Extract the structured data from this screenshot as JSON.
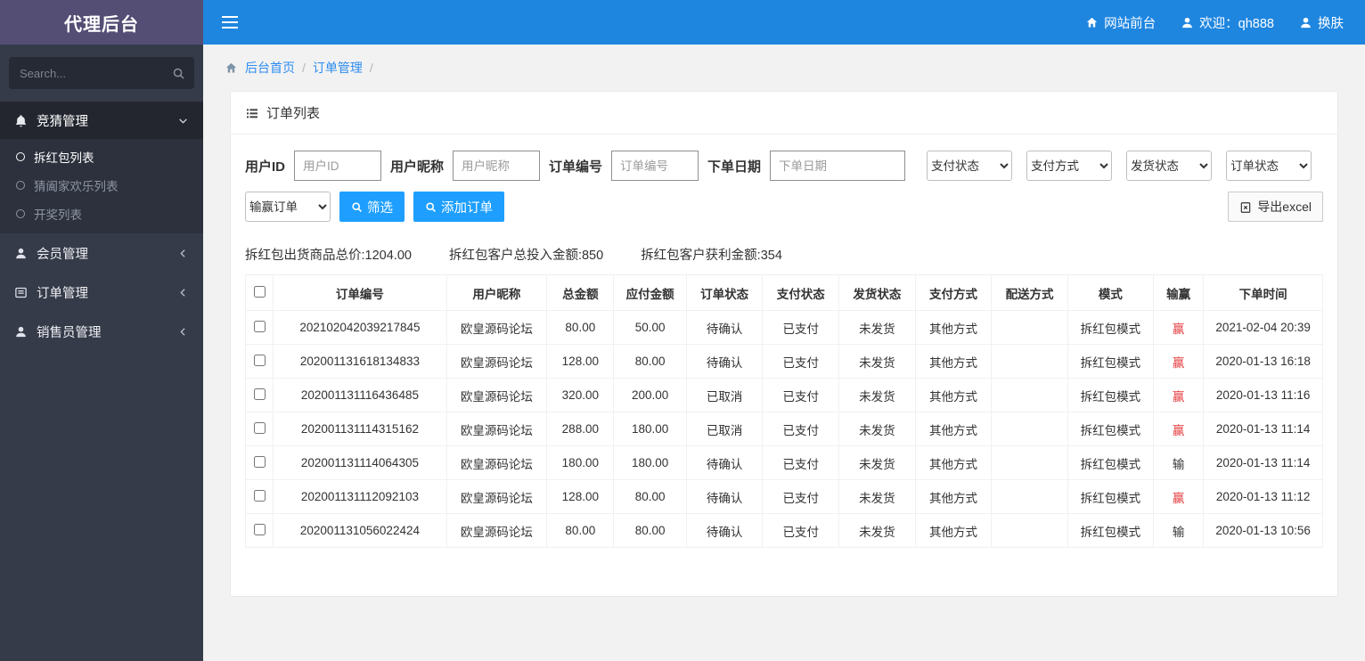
{
  "colors": {
    "topbar_blue": "#1f86e0",
    "brand_purple": "#544e75",
    "button_blue": "#1e9fff",
    "link_blue": "#2d8cf0",
    "win_red": "#e4393c",
    "sidebar_dark": "#363b4a"
  },
  "sidebar": {
    "brand": "代理后台",
    "search_placeholder": "Search...",
    "section": {
      "label": "竞猜管理",
      "items": [
        {
          "label": "拆红包列表",
          "active": true
        },
        {
          "label": "猜阖家欢乐列表",
          "active": false
        },
        {
          "label": "开奖列表",
          "active": false
        }
      ]
    },
    "items": [
      {
        "label": "会员管理"
      },
      {
        "label": "订单管理"
      },
      {
        "label": "销售员管理"
      }
    ]
  },
  "topbar": {
    "links": [
      {
        "label": "网站前台"
      },
      {
        "label": "欢迎：qh888"
      },
      {
        "label": "换肤"
      }
    ]
  },
  "breadcrumb": {
    "items": [
      {
        "label": "后台首页"
      },
      {
        "label": "订单管理"
      }
    ],
    "separator": "/"
  },
  "panel": {
    "title": "订单列表",
    "filters": {
      "user_id_label": "用户ID",
      "user_id_placeholder": "用户ID",
      "nickname_label": "用户昵称",
      "nickname_placeholder": "用户昵称",
      "order_no_label": "订单编号",
      "order_no_placeholder": "订单编号",
      "date_label": "下单日期",
      "date_placeholder": "下单日期",
      "selects": [
        "支付状态",
        "支付方式",
        "发货状态",
        "订单状态"
      ],
      "win_lose_select": "输赢订单",
      "filter_button": "筛选",
      "add_button": "添加订单",
      "export_button": "导出excel"
    },
    "stats": [
      "拆红包出货商品总价:1204.00",
      "拆红包客户总投入金额:850",
      "拆红包客户获利金额:354"
    ],
    "table": {
      "columns": [
        {
          "label": "订单编号",
          "blue": true
        },
        {
          "label": "用户昵称",
          "blue": true
        },
        {
          "label": "总金额",
          "blue": true
        },
        {
          "label": "应付金额",
          "blue": true
        },
        {
          "label": "订单状态",
          "blue": true
        },
        {
          "label": "支付状态",
          "blue": false
        },
        {
          "label": "发货状态",
          "blue": false
        },
        {
          "label": "支付方式",
          "blue": false
        },
        {
          "label": "配送方式",
          "blue": false
        },
        {
          "label": "模式",
          "blue": false
        },
        {
          "label": "输赢",
          "blue": false
        },
        {
          "label": "下单时间",
          "blue": true
        }
      ],
      "rows": [
        {
          "order_no": "202102042039217845",
          "nickname": "欧皇源码论坛",
          "total": "80.00",
          "payable": "50.00",
          "order_status": "待确认",
          "pay_status": "已支付",
          "ship_status": "未发货",
          "pay_method": "其他方式",
          "delivery": "",
          "mode": "拆红包模式",
          "result": "赢",
          "time": "2021-02-04 20:39"
        },
        {
          "order_no": "202001131618134833",
          "nickname": "欧皇源码论坛",
          "total": "128.00",
          "payable": "80.00",
          "order_status": "待确认",
          "pay_status": "已支付",
          "ship_status": "未发货",
          "pay_method": "其他方式",
          "delivery": "",
          "mode": "拆红包模式",
          "result": "赢",
          "time": "2020-01-13 16:18"
        },
        {
          "order_no": "202001131116436485",
          "nickname": "欧皇源码论坛",
          "total": "320.00",
          "payable": "200.00",
          "order_status": "已取消",
          "pay_status": "已支付",
          "ship_status": "未发货",
          "pay_method": "其他方式",
          "delivery": "",
          "mode": "拆红包模式",
          "result": "赢",
          "time": "2020-01-13 11:16"
        },
        {
          "order_no": "202001131114315162",
          "nickname": "欧皇源码论坛",
          "total": "288.00",
          "payable": "180.00",
          "order_status": "已取消",
          "pay_status": "已支付",
          "ship_status": "未发货",
          "pay_method": "其他方式",
          "delivery": "",
          "mode": "拆红包模式",
          "result": "赢",
          "time": "2020-01-13 11:14"
        },
        {
          "order_no": "202001131114064305",
          "nickname": "欧皇源码论坛",
          "total": "180.00",
          "payable": "180.00",
          "order_status": "待确认",
          "pay_status": "已支付",
          "ship_status": "未发货",
          "pay_method": "其他方式",
          "delivery": "",
          "mode": "拆红包模式",
          "result": "输",
          "time": "2020-01-13 11:14"
        },
        {
          "order_no": "202001131112092103",
          "nickname": "欧皇源码论坛",
          "total": "128.00",
          "payable": "80.00",
          "order_status": "待确认",
          "pay_status": "已支付",
          "ship_status": "未发货",
          "pay_method": "其他方式",
          "delivery": "",
          "mode": "拆红包模式",
          "result": "赢",
          "time": "2020-01-13 11:12"
        },
        {
          "order_no": "202001131056022424",
          "nickname": "欧皇源码论坛",
          "total": "80.00",
          "payable": "80.00",
          "order_status": "待确认",
          "pay_status": "已支付",
          "ship_status": "未发货",
          "pay_method": "其他方式",
          "delivery": "",
          "mode": "拆红包模式",
          "result": "输",
          "time": "2020-01-13 10:56"
        }
      ]
    }
  }
}
